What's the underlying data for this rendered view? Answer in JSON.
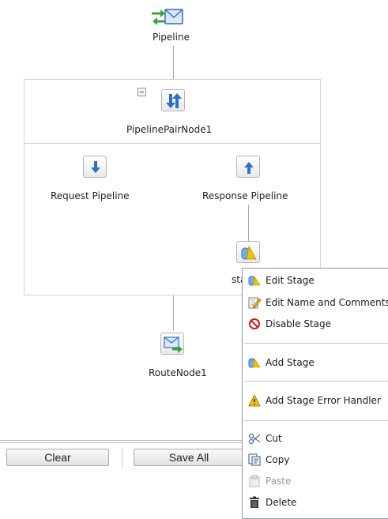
{
  "pipeline": {
    "label": "Pipeline"
  },
  "pipeline_pair": {
    "label": "PipelinePairNode1"
  },
  "request_pipeline": {
    "label": "Request Pipeline"
  },
  "response_pipeline": {
    "label": "Response Pipeline"
  },
  "stage": {
    "label": "sta"
  },
  "route_node": {
    "label": "RouteNode1"
  },
  "context_menu": {
    "edit_stage": "Edit Stage",
    "edit_name_comments": "Edit Name and Comments",
    "disable_stage": "Disable Stage",
    "add_stage": "Add Stage",
    "add_stage_error_handler": "Add Stage Error Handler",
    "cut": "Cut",
    "copy": "Copy",
    "paste": "Paste",
    "delete": "Delete"
  },
  "toolbar": {
    "clear_label": "Clear",
    "save_all_label": "Save All"
  },
  "colors": {
    "menu_border": "#8aa3b5",
    "icon_blue": "#2f6fc6",
    "icon_green": "#3aa53a",
    "warning_yellow": "#f2c200",
    "disable_red": "#d01f1f"
  }
}
